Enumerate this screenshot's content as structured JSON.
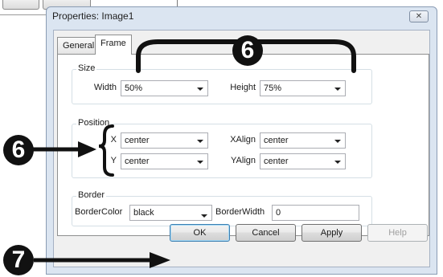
{
  "dialog": {
    "title": "Properties: Image1",
    "close_glyph": "✕"
  },
  "tabs": [
    {
      "label": "General",
      "active": false
    },
    {
      "label": "Frame",
      "active": true
    }
  ],
  "size_group": {
    "title": "Size",
    "width_label": "Width",
    "width_value": "50%",
    "height_label": "Height",
    "height_value": "75%"
  },
  "position_group": {
    "title": "Position",
    "x_label": "X",
    "x_value": "center",
    "y_label": "Y",
    "y_value": "center",
    "xalign_label": "XAlign",
    "xalign_value": "center",
    "yalign_label": "YAlign",
    "yalign_value": "center"
  },
  "border_group": {
    "title": "Border",
    "color_label": "BorderColor",
    "color_value": "black",
    "width_label": "BorderWidth",
    "width_value": "0"
  },
  "buttons": {
    "ok": "OK",
    "cancel": "Cancel",
    "apply": "Apply",
    "help": "Help"
  },
  "callouts": {
    "size_badge": "6",
    "position_badge": "6",
    "ok_badge": "7"
  },
  "colors": {
    "dialog_frame": "#dbe5f1",
    "callout": "#111111",
    "default_button_border": "#3c7fb1"
  }
}
